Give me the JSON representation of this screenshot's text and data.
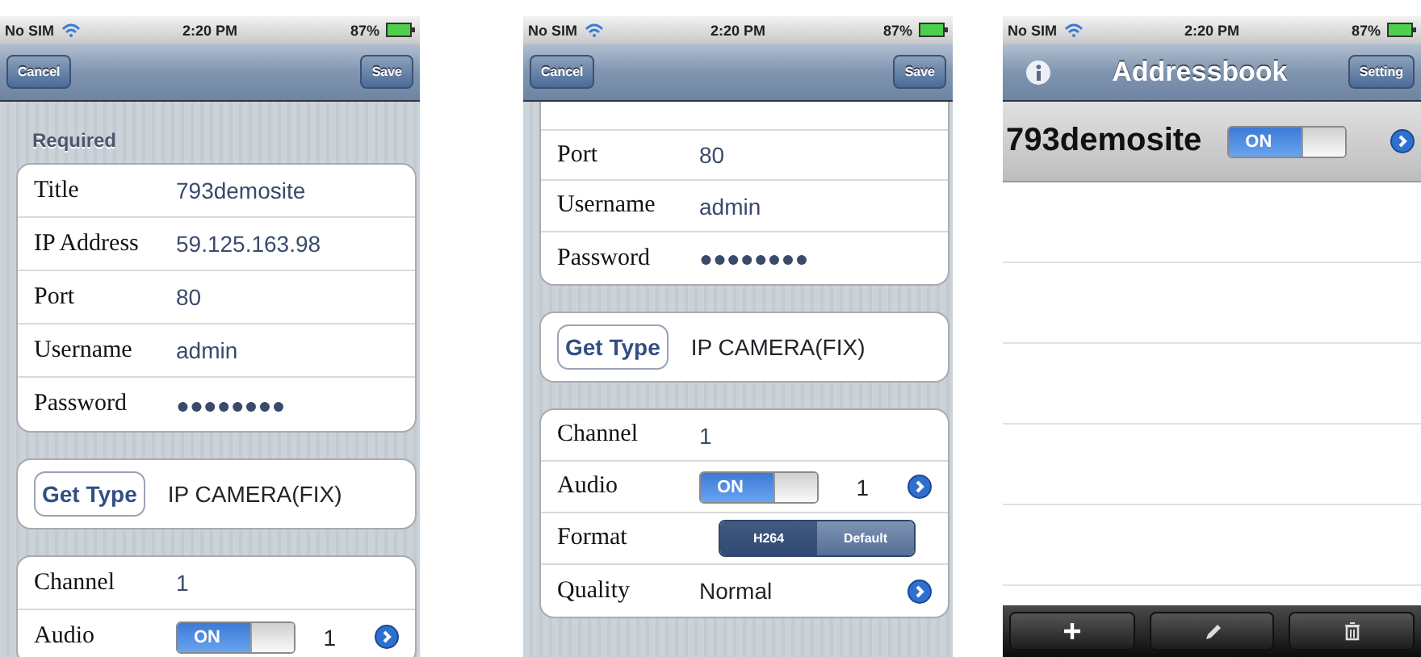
{
  "screens": [
    {
      "kind": "form",
      "status_bar": {
        "carrier": "No SIM",
        "time": "2:20 PM",
        "battery": "87%"
      },
      "nav": {
        "left_button": "Cancel",
        "right_button": "Save"
      },
      "sections": [
        {
          "header": "Required",
          "continued": false,
          "rows": [
            {
              "kind": "field",
              "label": "Title",
              "value": "793demosite"
            },
            {
              "kind": "field",
              "label": "IP Address",
              "value": "59.125.163.98"
            },
            {
              "kind": "field",
              "label": "Port",
              "value": "80"
            },
            {
              "kind": "field",
              "label": "Username",
              "value": "admin"
            },
            {
              "kind": "field",
              "label": "Password",
              "value": "●●●●●●●●"
            }
          ]
        },
        {
          "continued": false,
          "rows": [
            {
              "kind": "button_value",
              "button": "Get Type",
              "value": "IP CAMERA(FIX)"
            }
          ]
        },
        {
          "continued": false,
          "rows": [
            {
              "kind": "field",
              "label": "Channel",
              "value": "1"
            },
            {
              "kind": "switch",
              "label": "Audio",
              "switch": {
                "text": "ON",
                "on": true
              },
              "value": "1",
              "disclosure": true
            }
          ]
        }
      ]
    },
    {
      "kind": "form",
      "status_bar": {
        "carrier": "No SIM",
        "time": "2:20 PM",
        "battery": "87%"
      },
      "nav": {
        "left_button": "Cancel",
        "right_button": "Save"
      },
      "sections": [
        {
          "continued": true,
          "rows": [
            {
              "kind": "field",
              "label": "Port",
              "value": "80"
            },
            {
              "kind": "field",
              "label": "Username",
              "value": "admin"
            },
            {
              "kind": "field",
              "label": "Password",
              "value": "●●●●●●●●"
            }
          ]
        },
        {
          "continued": false,
          "rows": [
            {
              "kind": "button_value",
              "button": "Get Type",
              "value": "IP CAMERA(FIX)"
            }
          ]
        },
        {
          "continued": false,
          "rows": [
            {
              "kind": "field",
              "label": "Channel",
              "value": "1"
            },
            {
              "kind": "switch",
              "label": "Audio",
              "switch": {
                "text": "ON",
                "on": true
              },
              "value": "1",
              "disclosure": true
            },
            {
              "kind": "segmented",
              "label": "Format",
              "segments": [
                {
                  "label": "H264",
                  "selected": true
                },
                {
                  "label": "Default",
                  "selected": false
                }
              ]
            },
            {
              "kind": "select",
              "label": "Quality",
              "value": "Normal",
              "disclosure": true
            }
          ]
        }
      ]
    },
    {
      "kind": "list",
      "status_bar": {
        "carrier": "No SIM",
        "time": "2:20 PM",
        "battery": "87%"
      },
      "nav": {
        "title": "Addressbook",
        "right_button": "Setting"
      },
      "rows": [
        {
          "title": "793demosite",
          "switch": {
            "text": "ON",
            "on": true
          },
          "disclosure": true
        }
      ]
    }
  ]
}
